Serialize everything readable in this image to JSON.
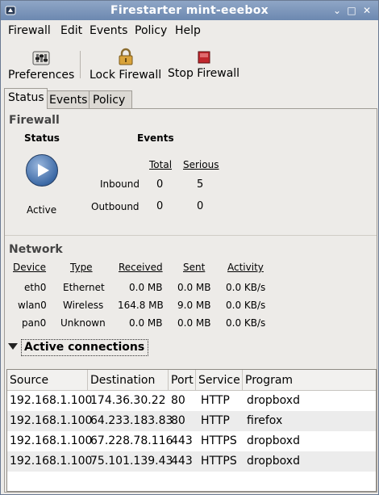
{
  "window": {
    "title": "Firestarter mint-eeebox",
    "app_icon": "firestarter-icon",
    "controls": [
      "⌄",
      "□",
      "✕"
    ]
  },
  "menu": [
    "Firewall",
    "Edit",
    "Events",
    "Policy",
    "Help"
  ],
  "toolbar": {
    "preferences": "Preferences",
    "lock": "Lock Firewall",
    "stop": "Stop Firewall"
  },
  "tabs": [
    "Status",
    "Events",
    "Policy"
  ],
  "firewall": {
    "heading": "Firewall",
    "status_label": "Status",
    "events_label": "Events",
    "state": "Active",
    "col_total": "Total",
    "col_serious": "Serious",
    "inbound_label": "Inbound",
    "outbound_label": "Outbound",
    "inbound_total": "0",
    "inbound_serious": "5",
    "outbound_total": "0",
    "outbound_serious": "0"
  },
  "network": {
    "heading": "Network",
    "headers": [
      "Device",
      "Type",
      "Received",
      "Sent",
      "Activity"
    ],
    "rows": [
      [
        "eth0",
        "Ethernet",
        "0.0 MB",
        "0.0 MB",
        "0.0 KB/s"
      ],
      [
        "wlan0",
        "Wireless",
        "164.8 MB",
        "9.0 MB",
        "0.0 KB/s"
      ],
      [
        "pan0",
        "Unknown",
        "0.0 MB",
        "0.0 MB",
        "0.0 KB/s"
      ]
    ]
  },
  "connections": {
    "title": "Active connections",
    "headers": [
      "Source",
      "Destination",
      "Port",
      "Service",
      "Program"
    ],
    "rows": [
      [
        "192.168.1.100",
        "174.36.30.22",
        "80",
        "HTTP",
        "dropboxd"
      ],
      [
        "192.168.1.100",
        "64.233.183.83",
        "80",
        "HTTP",
        "firefox"
      ],
      [
        "192.168.1.100",
        "67.228.78.116",
        "443",
        "HTTPS",
        "dropboxd"
      ],
      [
        "192.168.1.100",
        "75.101.139.43",
        "443",
        "HTTPS",
        "dropboxd"
      ]
    ]
  },
  "colors": {
    "titlebar": "#7a93b8",
    "stop_red": "#c0272d",
    "play_blue": "#3d6aa6"
  }
}
